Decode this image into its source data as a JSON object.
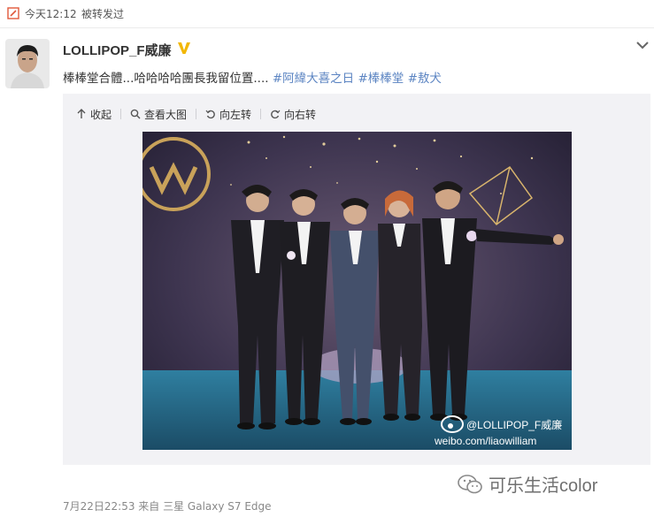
{
  "topbar": {
    "time": "今天12:12",
    "status": "被转发过"
  },
  "post": {
    "username": "LOLLIPOP_F威廉",
    "text_plain": "棒棒堂合體...哈哈哈哈團長我留位置....",
    "hashtags": [
      "#阿緯大喜之日",
      "#棒棒堂",
      "#敖犬"
    ],
    "footer": "7月22日22:53 来自 三星 Galaxy S7 Edge"
  },
  "toolbar": {
    "collapse": "收起",
    "view_large": "查看大图",
    "rotate_left": "向左转",
    "rotate_right": "向右转"
  },
  "photo": {
    "weibo_handle": "@LOLLIPOP_F威廉",
    "weibo_url": "weibo.com/liaowilliam"
  },
  "watermark": {
    "text": "可乐生活color"
  },
  "colors": {
    "hashtag": "#5b84c2",
    "verified": "#f2b705",
    "panel": "#f2f2f5"
  }
}
